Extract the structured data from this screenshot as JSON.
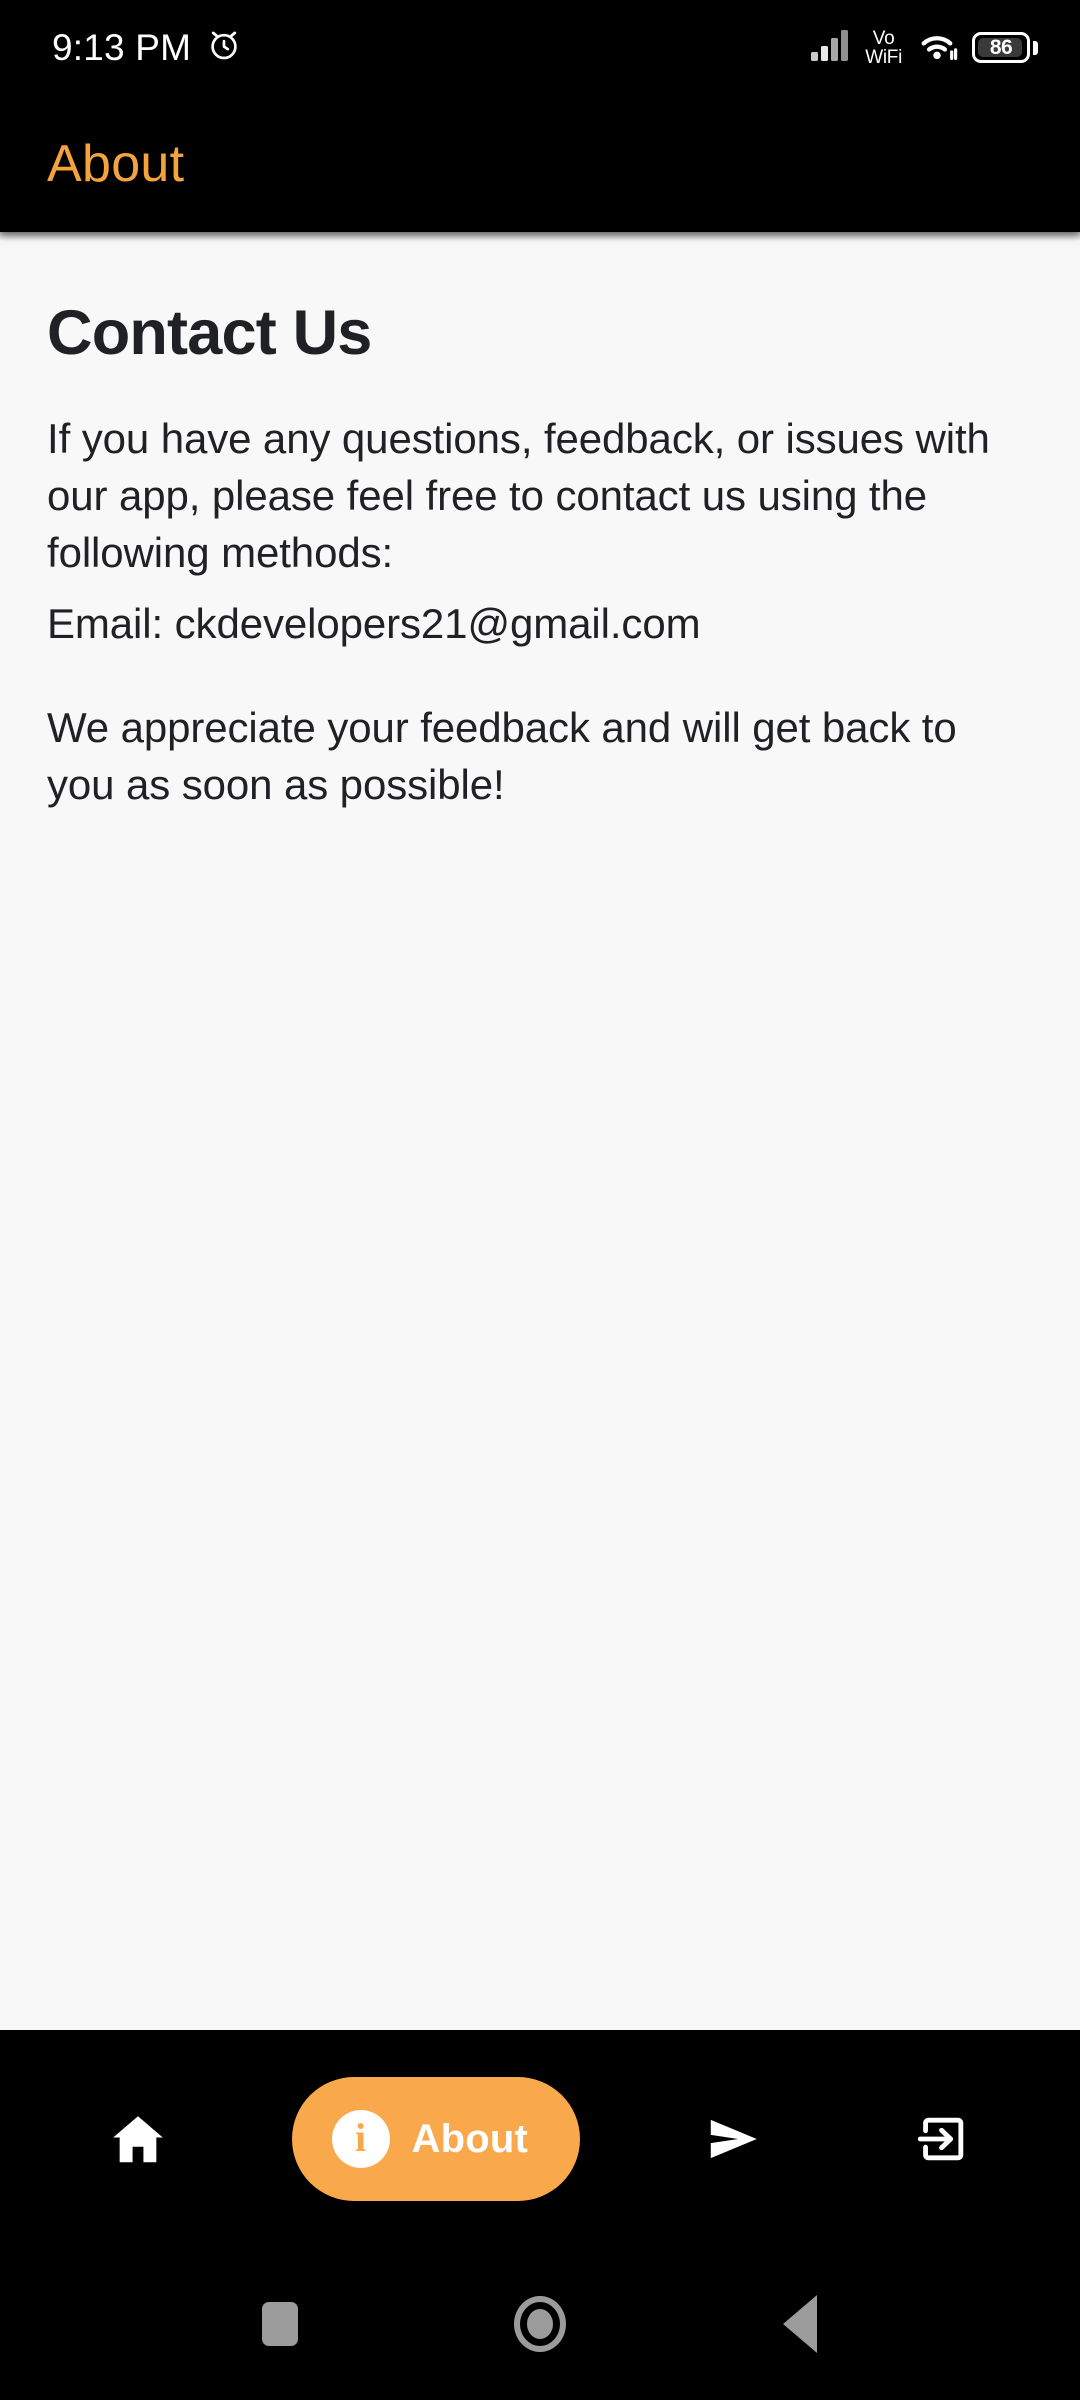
{
  "status_bar": {
    "time": "9:13 PM",
    "alarm_icon": "alarm-clock-icon",
    "signal_icon": "cellular-signal-icon",
    "vowifi_line1": "Vo",
    "vowifi_line2": "WiFi",
    "wifi_icon": "wifi-icon",
    "battery_percent": "86"
  },
  "app_bar": {
    "title": "About",
    "title_color": "#F5A33C",
    "background_color": "#000000"
  },
  "content": {
    "background_color": "#F8F8F8",
    "heading": "Contact Us",
    "paragraph_1": "If you have any questions, feedback, or issues with our app, please feel free to contact us using the following methods:",
    "paragraph_2": "Email: ckdevelopers21@gmail.com",
    "paragraph_3": "We appreciate your feedback and will get back to you as soon as possible!"
  },
  "bottom_nav": {
    "background_color": "#000000",
    "active_color": "#F9A94C",
    "items": [
      {
        "name": "home",
        "icon": "home-icon",
        "label": "",
        "active": false
      },
      {
        "name": "about",
        "icon": "info-icon",
        "label": "About",
        "active": true
      },
      {
        "name": "send",
        "icon": "send-icon",
        "label": "",
        "active": false
      },
      {
        "name": "logout",
        "icon": "exit-to-app-icon",
        "label": "",
        "active": false
      }
    ]
  },
  "android_nav": {
    "recents_label": "recents-square-icon",
    "home_label": "home-circle-icon",
    "back_label": "back-triangle-icon"
  }
}
